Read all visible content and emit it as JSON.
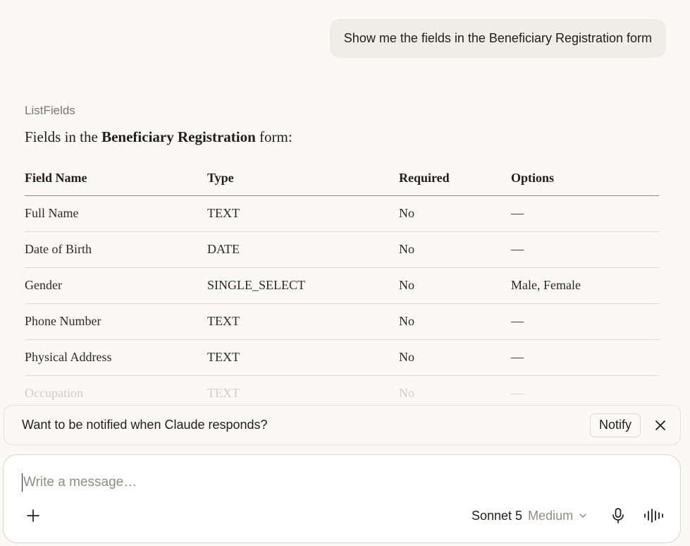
{
  "user_message": "Show me the fields in the Beneficiary Registration form",
  "tool_label": "ListFields",
  "intro": {
    "prefix": "Fields in the ",
    "form_name": "Beneficiary Registration",
    "suffix": " form:"
  },
  "table": {
    "headers": [
      "Field Name",
      "Type",
      "Required",
      "Options"
    ],
    "rows": [
      [
        "Full Name",
        "TEXT",
        "No",
        "—"
      ],
      [
        "Date of Birth",
        "DATE",
        "No",
        "—"
      ],
      [
        "Gender",
        "SINGLE_SELECT",
        "No",
        "Male, Female"
      ],
      [
        "Phone Number",
        "TEXT",
        "No",
        "—"
      ],
      [
        "Physical Address",
        "TEXT",
        "No",
        "—"
      ],
      [
        "Occupation",
        "TEXT",
        "No",
        "—"
      ]
    ]
  },
  "notify": {
    "text": "Want to be notified when Claude responds?",
    "button": "Notify",
    "close_icon": "close-icon"
  },
  "composer": {
    "placeholder": "Write a message…",
    "model": "Sonnet 5",
    "effort": "Medium",
    "icons": [
      "plus-icon",
      "chevron-down-icon",
      "microphone-icon",
      "voice-waveform-icon"
    ]
  }
}
